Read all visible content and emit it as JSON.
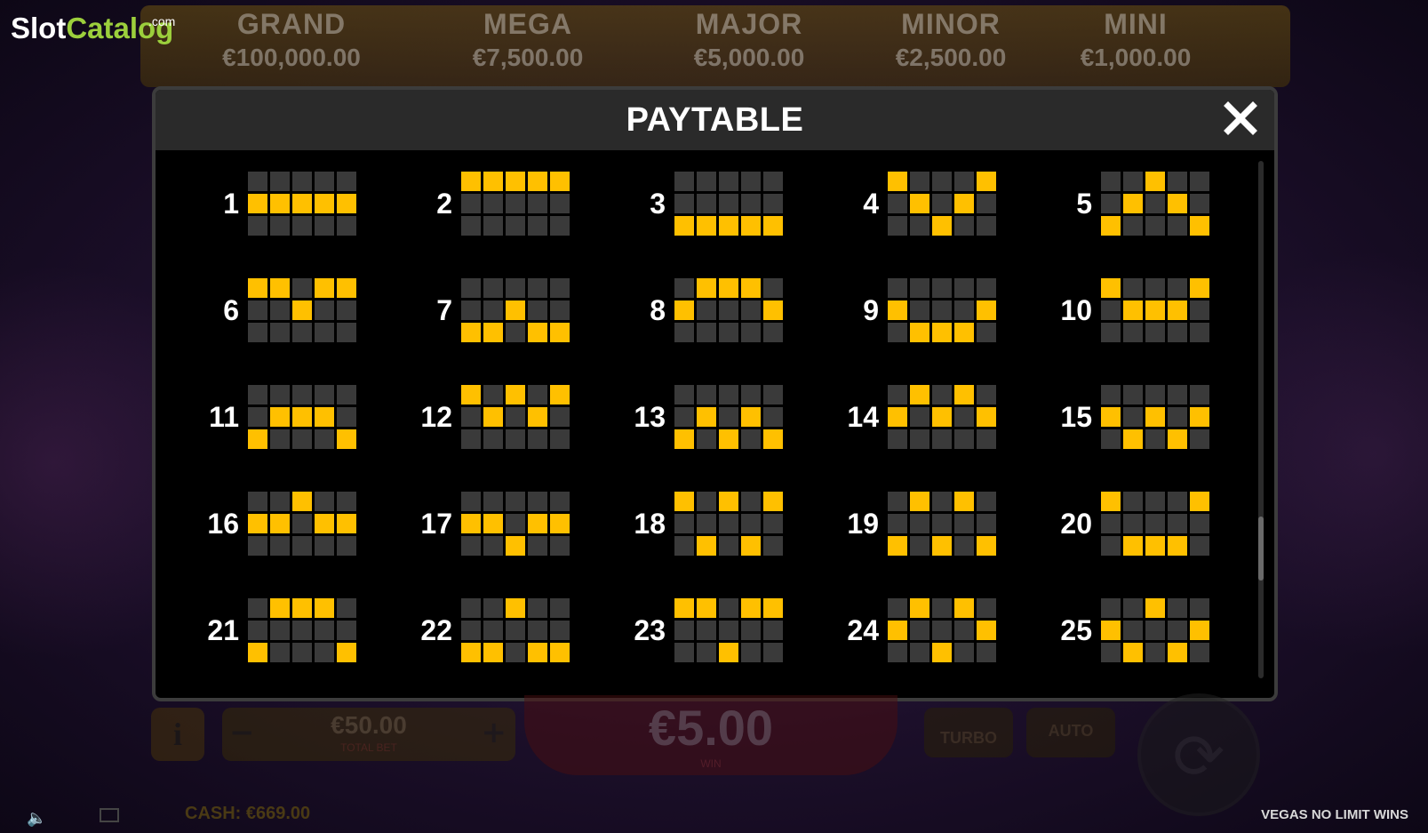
{
  "logo": {
    "slot": "Slot",
    "catalog": "Catalog",
    "com": ".com"
  },
  "jackpots": [
    {
      "name": "GRAND",
      "value": "€100,000.00",
      "color": "#6f5410"
    },
    {
      "name": "MEGA",
      "value": "€7,500.00",
      "color": "#6a0f1a"
    },
    {
      "name": "MAJOR",
      "value": "€5,000.00",
      "color": "#5a0d18"
    },
    {
      "name": "MINOR",
      "value": "€2,500.00",
      "color": "#0c1d5c"
    },
    {
      "name": "MINI",
      "value": "€1,000.00",
      "color": "#0f3a16"
    }
  ],
  "modal": {
    "title": "PAYTABLE",
    "close_icon": "close-icon"
  },
  "paylines": [
    {
      "number": "1",
      "rows": [
        1,
        1,
        1,
        1,
        1
      ]
    },
    {
      "number": "2",
      "rows": [
        0,
        0,
        0,
        0,
        0
      ]
    },
    {
      "number": "3",
      "rows": [
        2,
        2,
        2,
        2,
        2
      ]
    },
    {
      "number": "4",
      "rows": [
        0,
        1,
        2,
        1,
        0
      ]
    },
    {
      "number": "5",
      "rows": [
        2,
        1,
        0,
        1,
        2
      ]
    },
    {
      "number": "6",
      "rows": [
        0,
        0,
        1,
        0,
        0
      ]
    },
    {
      "number": "7",
      "rows": [
        2,
        2,
        1,
        2,
        2
      ]
    },
    {
      "number": "8",
      "rows": [
        1,
        0,
        0,
        0,
        1
      ]
    },
    {
      "number": "9",
      "rows": [
        1,
        2,
        2,
        2,
        1
      ]
    },
    {
      "number": "10",
      "rows": [
        0,
        1,
        1,
        1,
        0
      ]
    },
    {
      "number": "11",
      "rows": [
        2,
        1,
        1,
        1,
        2
      ]
    },
    {
      "number": "12",
      "rows": [
        0,
        1,
        0,
        1,
        0
      ]
    },
    {
      "number": "13",
      "rows": [
        2,
        1,
        2,
        1,
        2
      ]
    },
    {
      "number": "14",
      "rows": [
        1,
        0,
        1,
        0,
        1
      ]
    },
    {
      "number": "15",
      "rows": [
        1,
        2,
        1,
        2,
        1
      ]
    },
    {
      "number": "16",
      "rows": [
        1,
        1,
        0,
        1,
        1
      ]
    },
    {
      "number": "17",
      "rows": [
        1,
        1,
        2,
        1,
        1
      ]
    },
    {
      "number": "18",
      "rows": [
        0,
        2,
        0,
        2,
        0
      ]
    },
    {
      "number": "19",
      "rows": [
        2,
        0,
        2,
        0,
        2
      ]
    },
    {
      "number": "20",
      "rows": [
        0,
        2,
        2,
        2,
        0
      ]
    },
    {
      "number": "21",
      "rows": [
        2,
        0,
        0,
        0,
        2
      ]
    },
    {
      "number": "22",
      "rows": [
        2,
        2,
        0,
        2,
        2
      ]
    },
    {
      "number": "23",
      "rows": [
        0,
        0,
        2,
        0,
        0
      ]
    },
    {
      "number": "24",
      "rows": [
        1,
        0,
        2,
        0,
        1
      ]
    },
    {
      "number": "25",
      "rows": [
        1,
        2,
        0,
        2,
        1
      ]
    }
  ],
  "controls": {
    "info_label": "i",
    "bet_minus": "−",
    "bet_plus": "+",
    "total_bet_value": "€50.00",
    "total_bet_label": "TOTAL BET",
    "win_value": "€5.00",
    "win_label": "WIN",
    "turbo_label": "TURBO",
    "auto_label": "AUTO",
    "spin_icon": "⟳"
  },
  "footer": {
    "cash": "CASH: €669.00",
    "game_title": "VEGAS NO LIMIT WINS"
  }
}
